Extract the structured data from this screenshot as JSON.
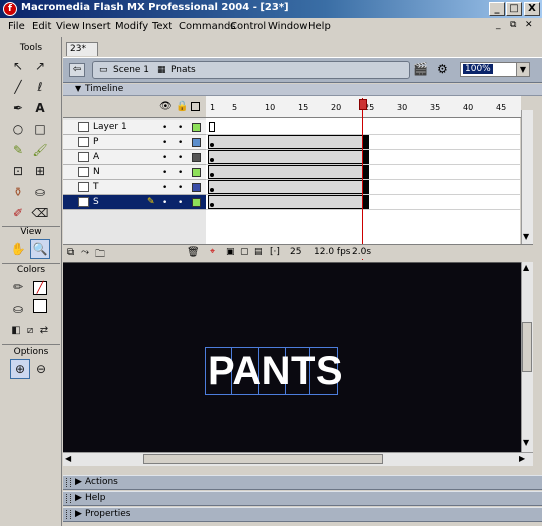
{
  "window": {
    "title": "Macromedia Flash MX Professional 2004 - [23*]",
    "icon_letter": "f",
    "buttons": [
      "_",
      "□",
      "X"
    ]
  },
  "menu": [
    "File",
    "Edit",
    "View",
    "Insert",
    "Modify",
    "Text",
    "Commands",
    "Control",
    "Window",
    "Help"
  ],
  "tools": {
    "heading": "Tools",
    "view_heading": "View",
    "colors_heading": "Colors",
    "options_heading": "Options"
  },
  "document": {
    "tab": "23*",
    "scene": "Scene 1",
    "symbol": "Pnats",
    "zoom": "100%"
  },
  "timeline": {
    "label": "Timeline",
    "frame_numbers": [
      "1",
      "5",
      "10",
      "15",
      "20",
      "25",
      "30",
      "35",
      "40",
      "45"
    ],
    "layers": [
      {
        "name": "Layer 1",
        "color": "#8ee05a"
      },
      {
        "name": "P",
        "color": "#5b8ecc"
      },
      {
        "name": "A",
        "color": "#555555"
      },
      {
        "name": "N",
        "color": "#8ee05a"
      },
      {
        "name": "T",
        "color": "#3a4ea8"
      },
      {
        "name": "S",
        "color": "#8ee05a"
      }
    ],
    "current_frame": "25",
    "fps": "12.0 fps",
    "time": "2.0s"
  },
  "stage": {
    "text": "PANTS",
    "background": "#0a0910"
  },
  "panels": [
    "Actions",
    "Help",
    "Properties"
  ]
}
